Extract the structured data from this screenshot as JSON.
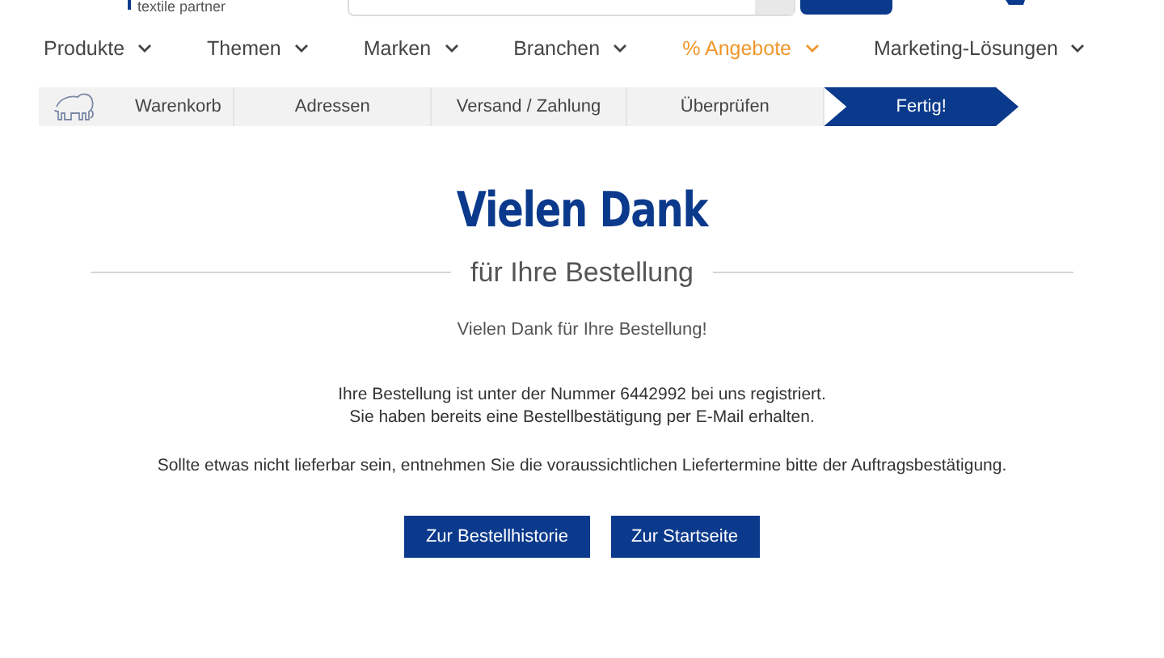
{
  "header": {
    "tagline": "textile partner"
  },
  "nav": [
    {
      "label": "Produkte",
      "kind": "normal"
    },
    {
      "label": "Themen",
      "kind": "normal"
    },
    {
      "label": "Marken",
      "kind": "normal"
    },
    {
      "label": "Branchen",
      "kind": "normal"
    },
    {
      "label": "% Angebote",
      "kind": "promo"
    },
    {
      "label": "Marketing-Lösungen",
      "kind": "normal"
    }
  ],
  "steps": [
    {
      "label": "Warenkorb",
      "selected": false
    },
    {
      "label": "Adressen",
      "selected": false
    },
    {
      "label": "Versand / Zahlung",
      "selected": false
    },
    {
      "label": "Überprüfen",
      "selected": false
    },
    {
      "label": "Fertig!",
      "selected": true
    }
  ],
  "title": "Vielen Dank",
  "subtitle": "für Ihre Bestellung",
  "intro": "Vielen Dank für Ihre Bestellung!",
  "paragraphs": [
    "Ihre Bestellung ist unter der Nummer 6442992 bei uns registriert.",
    "Sie haben bereits eine Bestellbestätigung per E-Mail erhalten.",
    "Sollte etwas nicht lieferbar sein, entnehmen Sie die voraussichtlichen Liefertermine bitte der Auftragsbestätigung."
  ],
  "buttons": [
    "Zur Bestellhistorie",
    "Zur Startseite"
  ]
}
